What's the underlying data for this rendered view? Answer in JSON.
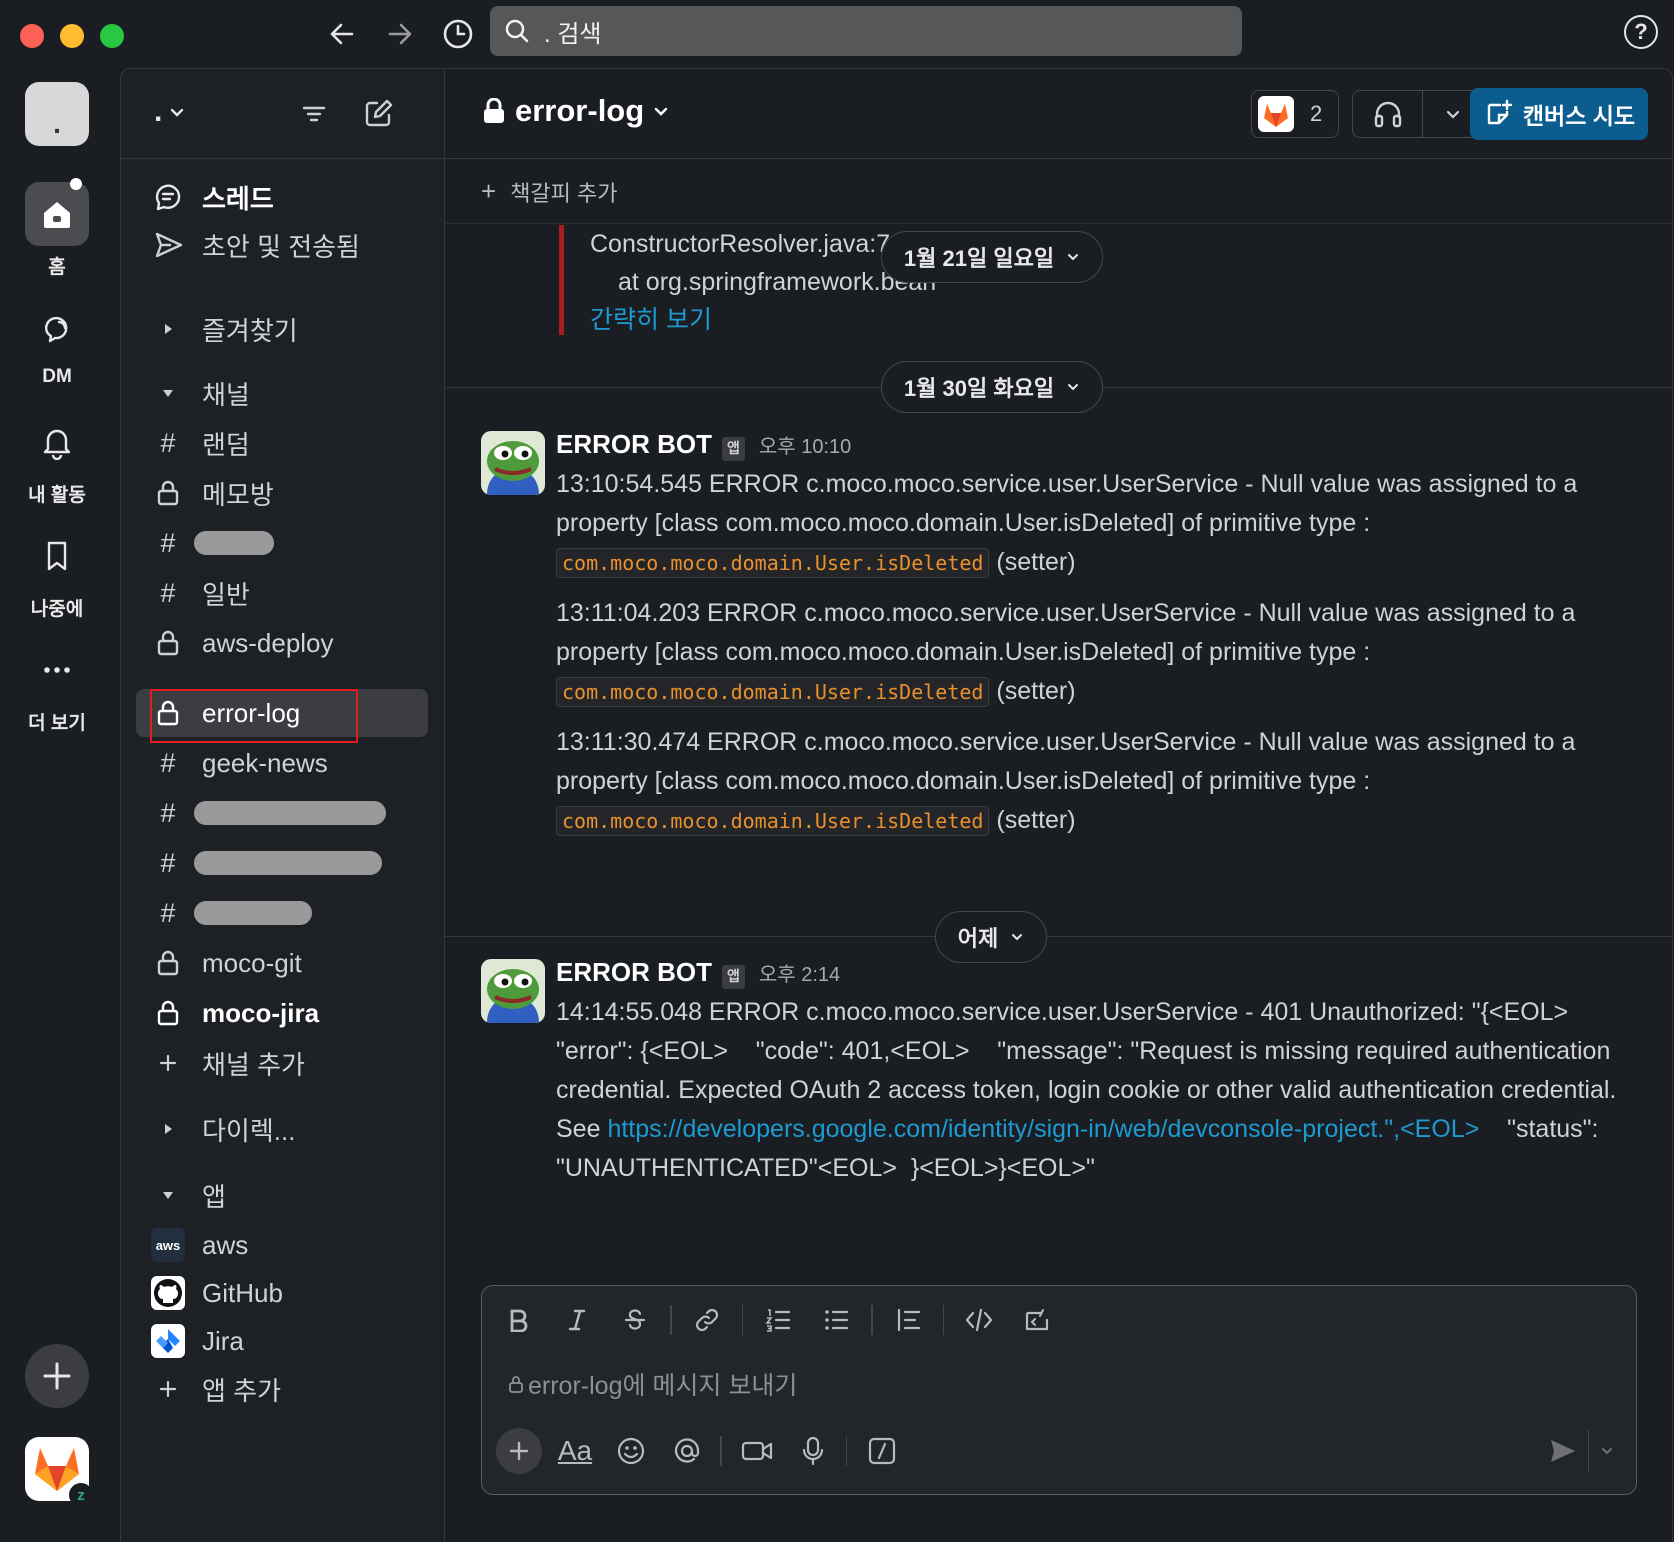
{
  "titlebar": {
    "search_text": ". 검색"
  },
  "rail": {
    "workspace_initial": ".",
    "items": [
      {
        "label": "홈",
        "icon": "home-icon"
      },
      {
        "label": "DM",
        "icon": "dm-icon"
      },
      {
        "label": "내 활동",
        "icon": "bell-icon"
      },
      {
        "label": "나중에",
        "icon": "bookmark-icon"
      },
      {
        "label": "더 보기",
        "icon": "more-icon"
      }
    ],
    "gitlab_badge": "z"
  },
  "sidebar": {
    "workspace_name": ".",
    "top_items": [
      {
        "label": "스레드",
        "icon": "threads-icon"
      },
      {
        "label": "초안 및 전송됨",
        "icon": "send-icon"
      }
    ],
    "favorites_label": "즐겨찾기",
    "channels_label": "채널",
    "channels": [
      {
        "name": "랜덤",
        "type": "hash"
      },
      {
        "name": "메모방",
        "type": "lock"
      },
      {
        "name": "",
        "type": "hash"
      },
      {
        "name": "일반",
        "type": "hash"
      },
      {
        "name": "aws-deploy",
        "type": "lock"
      },
      {
        "name": "error-log",
        "type": "lock"
      },
      {
        "name": "geek-news",
        "type": "hash"
      },
      {
        "name": "",
        "type": "hash"
      },
      {
        "name": "",
        "type": "hash"
      },
      {
        "name": "",
        "type": "hash"
      },
      {
        "name": "moco-git",
        "type": "lock"
      },
      {
        "name": "moco-jira",
        "type": "lock"
      }
    ],
    "add_channel_label": "채널 추가",
    "dm_label": "다이렉...",
    "apps_label": "앱",
    "apps": [
      {
        "name": "aws",
        "logo_text": "aws"
      },
      {
        "name": "GitHub",
        "logo_text": ""
      },
      {
        "name": "Jira",
        "logo_text": ""
      }
    ],
    "add_app_label": "앱 추가"
  },
  "channel": {
    "name": "error-log",
    "member_count": "2",
    "canvas_label": "캔버스 시도",
    "bookmark_label": "책갈피 추가"
  },
  "messages": {
    "prev": {
      "line1": "ConstructorResolver.java:793)",
      "line2": "at org.springframework.bean",
      "collapse_link": "간략히 보기"
    },
    "dividers": [
      "1월 21일 일요일",
      "1월 30일 화요일",
      "어제"
    ],
    "msg1": {
      "sender": "ERROR BOT",
      "tag": "앱",
      "time": "오후 10:10",
      "entries": [
        {
          "text": "13:10:54.545 ERROR c.moco.moco.service.user.UserService - Null value was assigned to a property [class com.moco.moco.domain.User.isDeleted] of primitive type :",
          "code": "com.moco.moco.domain.User.isDeleted",
          "suffix": "(setter)"
        },
        {
          "text": "13:11:04.203 ERROR c.moco.moco.service.user.UserService - Null value was assigned to a property [class com.moco.moco.domain.User.isDeleted] of primitive type :",
          "code": "com.moco.moco.domain.User.isDeleted",
          "suffix": "(setter)"
        },
        {
          "text": "13:11:30.474 ERROR c.moco.moco.service.user.UserService - Null value was assigned to a property [class com.moco.moco.domain.User.isDeleted] of primitive type :",
          "code": "com.moco.moco.domain.User.isDeleted",
          "suffix": "(setter)"
        }
      ]
    },
    "msg2": {
      "sender": "ERROR BOT",
      "tag": "앱",
      "time": "오후 2:14",
      "text_before": "14:14:55.048 ERROR c.moco.moco.service.user.UserService - 401 Unauthorized: \"{<EOL> \"error\": {<EOL>    \"code\": 401,<EOL>    \"message\": \"Request is missing required authentication credential. Expected OAuth 2 access token, login cookie or other valid authentication credential. See ",
      "link": "https://developers.google.com/identity/sign-in/web/devconsole-project.\",<EOL>",
      "text_after": "    \"status\": \"UNAUTHENTICATED\"<EOL>  }<EOL>}<EOL>\""
    }
  },
  "composer": {
    "placeholder": "error-log에 메시지 보내기",
    "format_label": "Aa"
  },
  "colors": {
    "accent_blue": "#1d9bd1",
    "canvas_button": "#0b5d8f",
    "selection_red": "#e01e1e",
    "code_orange": "#e8912d",
    "error_bar": "#a51d1d"
  }
}
